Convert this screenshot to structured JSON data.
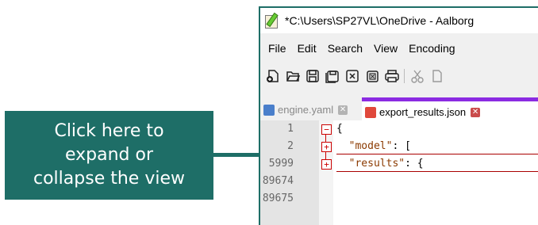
{
  "callout": {
    "text": "Click here to\nexpand or\ncollapse the view"
  },
  "window": {
    "title": "*C:\\Users\\SP27VL\\OneDrive - Aalborg"
  },
  "menu": [
    "File",
    "Edit",
    "Search",
    "View",
    "Encoding"
  ],
  "toolbar": [
    "new-icon",
    "open-icon",
    "save-icon",
    "save-all-icon",
    "close-icon",
    "close-all-icon",
    "print-icon",
    "cut-icon",
    "copy-icon"
  ],
  "tabs": [
    {
      "label": "engine.yaml",
      "active": false,
      "close": "✕"
    },
    {
      "label": "export_results.json",
      "active": true,
      "close": "✕"
    }
  ],
  "editor": {
    "lines": [
      {
        "num": "1",
        "fold": "−",
        "text": "{"
      },
      {
        "num": "2",
        "fold": "+",
        "key": "\"model\"",
        "rest": ": ["
      },
      {
        "num": "5999",
        "fold": "+",
        "key": "\"results\"",
        "rest": ": {"
      },
      {
        "num": "89674",
        "fold": "",
        "text": ""
      },
      {
        "num": "89675",
        "fold": "",
        "text": ""
      }
    ]
  },
  "colors": {
    "callout_bg": "#1e6e67",
    "active_tab_accent": "#8b2be2",
    "fold_marker": "#cc0000"
  }
}
